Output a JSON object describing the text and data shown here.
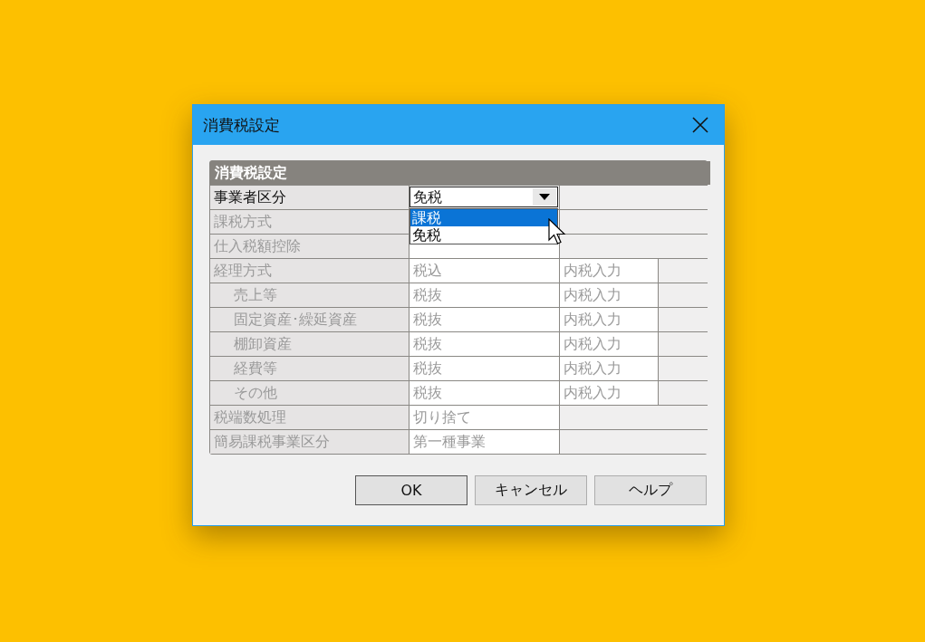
{
  "window": {
    "title": "消費税設定"
  },
  "settings": {
    "title": "消費税設定",
    "rows": [
      {
        "label": "事業者区分",
        "kind": "dropdown",
        "value": "免税",
        "disabled": false,
        "expanded": true,
        "options": [
          {
            "label": "課税",
            "highlighted": true
          },
          {
            "label": "免税",
            "highlighted": false
          }
        ]
      },
      {
        "label": "課税方式",
        "kind": "text",
        "disabled": true
      },
      {
        "label": "仕入税額控除",
        "kind": "text",
        "disabled": true
      },
      {
        "label": "経理方式",
        "kind": "text",
        "value": "税込",
        "column_3": "内税入力",
        "disabled": true,
        "children": [
          {
            "label": "売上等",
            "kind": "text",
            "value": "税抜",
            "column_3": "内税入力",
            "disabled": true
          },
          {
            "label": "固定資産･繰延資産",
            "kind": "text",
            "value": "税抜",
            "column_3": "内税入力",
            "disabled": true
          },
          {
            "label": "棚卸資産",
            "kind": "text",
            "value": "税抜",
            "column_3": "内税入力",
            "disabled": true
          },
          {
            "label": "経費等",
            "kind": "text",
            "value": "税抜",
            "column_3": "内税入力",
            "disabled": true
          },
          {
            "label": "その他",
            "kind": "text",
            "value": "税抜",
            "column_3": "内税入力",
            "disabled": true
          }
        ]
      },
      {
        "label": "税端数処理",
        "kind": "text",
        "value": "切り捨て",
        "disabled": true
      },
      {
        "label": "簡易課税事業区分",
        "kind": "text",
        "value": "第一種事業",
        "disabled": true
      }
    ]
  },
  "buttons": [
    "OK",
    "キャンセル",
    "ヘルプ"
  ]
}
